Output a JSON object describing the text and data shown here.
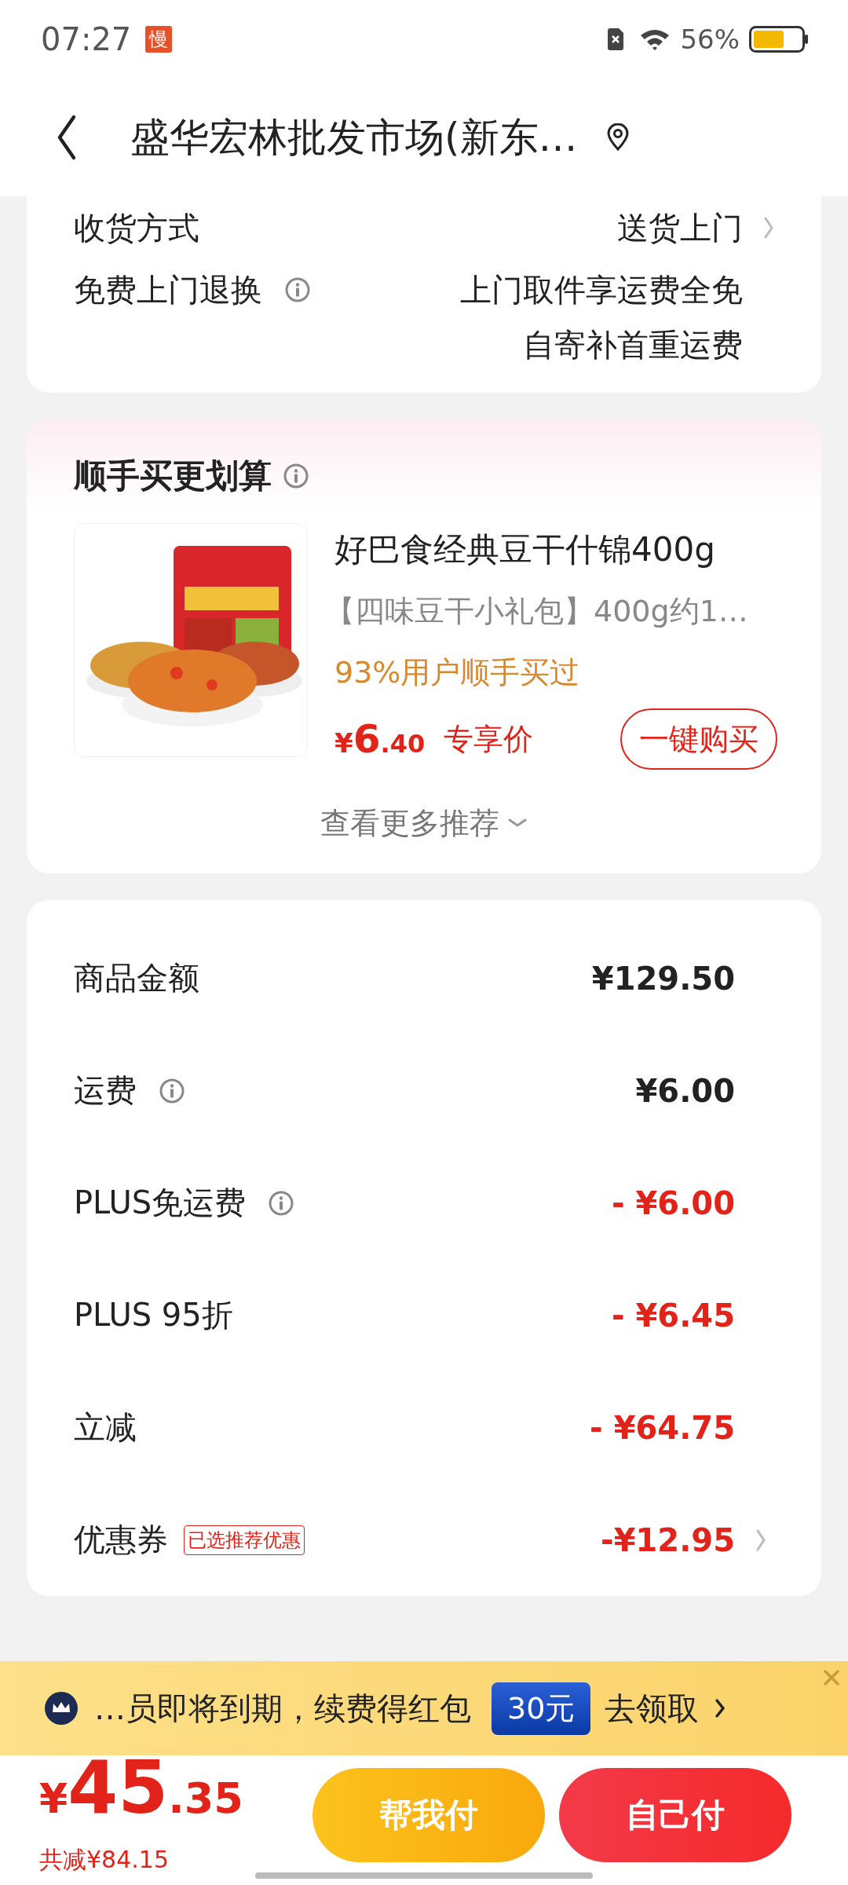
{
  "status_bar": {
    "time": "07:27",
    "app_badge": "慢",
    "battery_text": "56%"
  },
  "header": {
    "title": "盛华宏林批发市场(新东…"
  },
  "delivery": {
    "rows": [
      {
        "label": "收货方式",
        "info": false,
        "values": [
          "送货上门"
        ],
        "chevron": true
      },
      {
        "label": "免费上门退换",
        "info": true,
        "values": [
          "上门取件享运费全免",
          "自寄补首重运费"
        ],
        "chevron": false
      }
    ]
  },
  "recommend": {
    "title": "顺手买更划算",
    "product": {
      "name": "好巴食经典豆干什锦400g",
      "subtitle": "【四味豆干小礼包】400g约1…",
      "social": "93%用户顺手买过",
      "currency": "¥",
      "price_int": "6",
      "price_dec": ".40",
      "price_tag": "专享价",
      "buy_button": "一键购买"
    },
    "more": "查看更多推荐"
  },
  "summary": {
    "rows": [
      {
        "label": "商品金额",
        "info": false,
        "value": "¥129.50",
        "kind": "normal",
        "chevron": false
      },
      {
        "label": "运费",
        "info": true,
        "value": "¥6.00",
        "kind": "normal",
        "chevron": false
      },
      {
        "label": "PLUS免运费",
        "info": true,
        "value": "- ¥6.00",
        "kind": "discount",
        "chevron": false
      },
      {
        "label": "PLUS 95折",
        "info": false,
        "value": "- ¥6.45",
        "kind": "discount",
        "chevron": false
      },
      {
        "label": "立减",
        "info": false,
        "value": "- ¥64.75",
        "kind": "discount",
        "chevron": false
      },
      {
        "label": "优惠券",
        "info": false,
        "tag": "已选推荐优惠",
        "value": "-¥12.95",
        "kind": "discount",
        "chevron": true
      }
    ]
  },
  "banner": {
    "text": "…员即将到期，续费得红包",
    "amount": "30元",
    "action": "去领取"
  },
  "footer": {
    "currency": "¥",
    "total_int": "45",
    "total_dec": ".35",
    "saved": "共减¥84.15",
    "buttons": [
      {
        "label": "帮我付",
        "kind": "friend"
      },
      {
        "label": "自己付",
        "kind": "self"
      }
    ]
  }
}
